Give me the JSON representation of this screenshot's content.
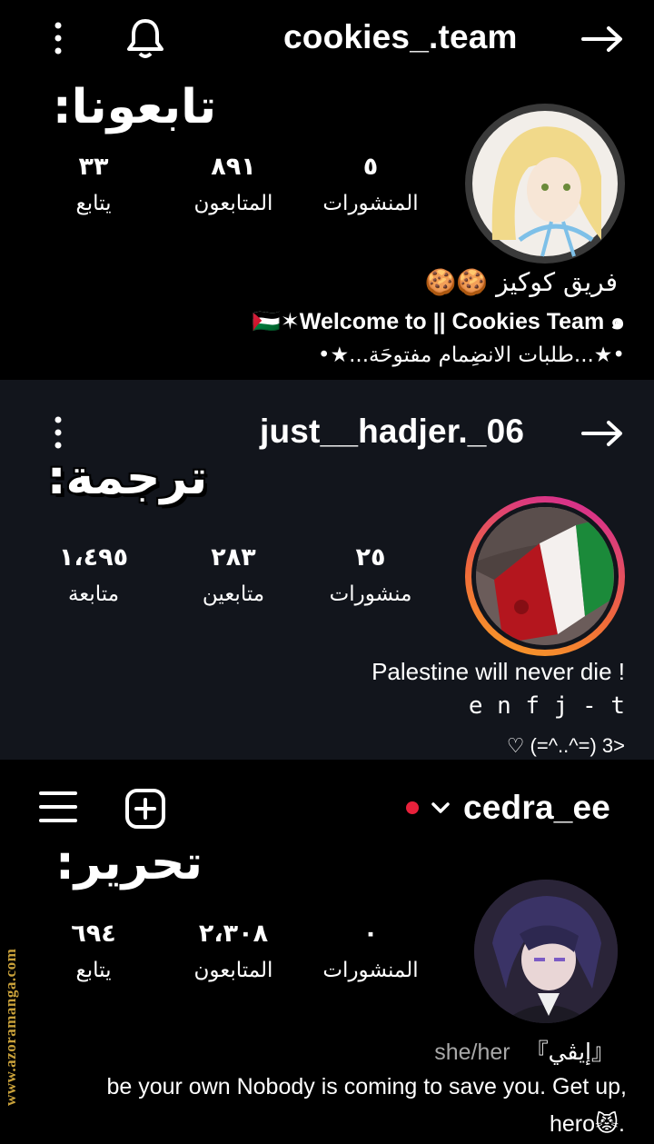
{
  "profiles": [
    {
      "username": "cookies_.team",
      "overlay": "تابعونا:",
      "stats": [
        {
          "value": "٥",
          "label": "المنشورات"
        },
        {
          "value": "٨٩١",
          "label": "المتابعون"
        },
        {
          "value": "٣٣",
          "label": "يتابع"
        }
      ],
      "bio": [
        "فريق كوكيز 🍪🍪",
        "🇵🇸✶Welcome to || Cookies Team ๑",
        "•★...طلبات الانضِمام مفتوحَة...★•"
      ]
    },
    {
      "username": "just__hadjer._06",
      "overlay": "ترجمة:",
      "stats": [
        {
          "value": "٢٥",
          "label": "منشورات"
        },
        {
          "value": "٢٨٣",
          "label": "متابعين"
        },
        {
          "value": "١،٤٩٥",
          "label": "متابعة"
        }
      ],
      "bio": [
        "! Palestine will never die",
        "e n f j - t",
        "<3 (=^..^=) ♡"
      ]
    },
    {
      "username": "cedra_ee",
      "overlay": "تحرير:",
      "stats": [
        {
          "value": "٠",
          "label": "المنشورات"
        },
        {
          "value": "٢،٣٠٨",
          "label": "المتابعون"
        },
        {
          "value": "٦٩٤",
          "label": "يتابع"
        }
      ],
      "pronouns": "she/her",
      "name_tag": "『إيڤي』",
      "bio": [
        "be your own Nobody is coming to save you. Get up,",
        ".😾hero"
      ]
    }
  ],
  "watermark": "www.azoramanga.com",
  "colors": {
    "panel_dark": "#000000",
    "panel_mid": "#12151c",
    "live_dot": "#e8213b",
    "story_ring_start": "#f9a125",
    "story_ring_end": "#d2259c",
    "watermark": "#c9a13a"
  }
}
